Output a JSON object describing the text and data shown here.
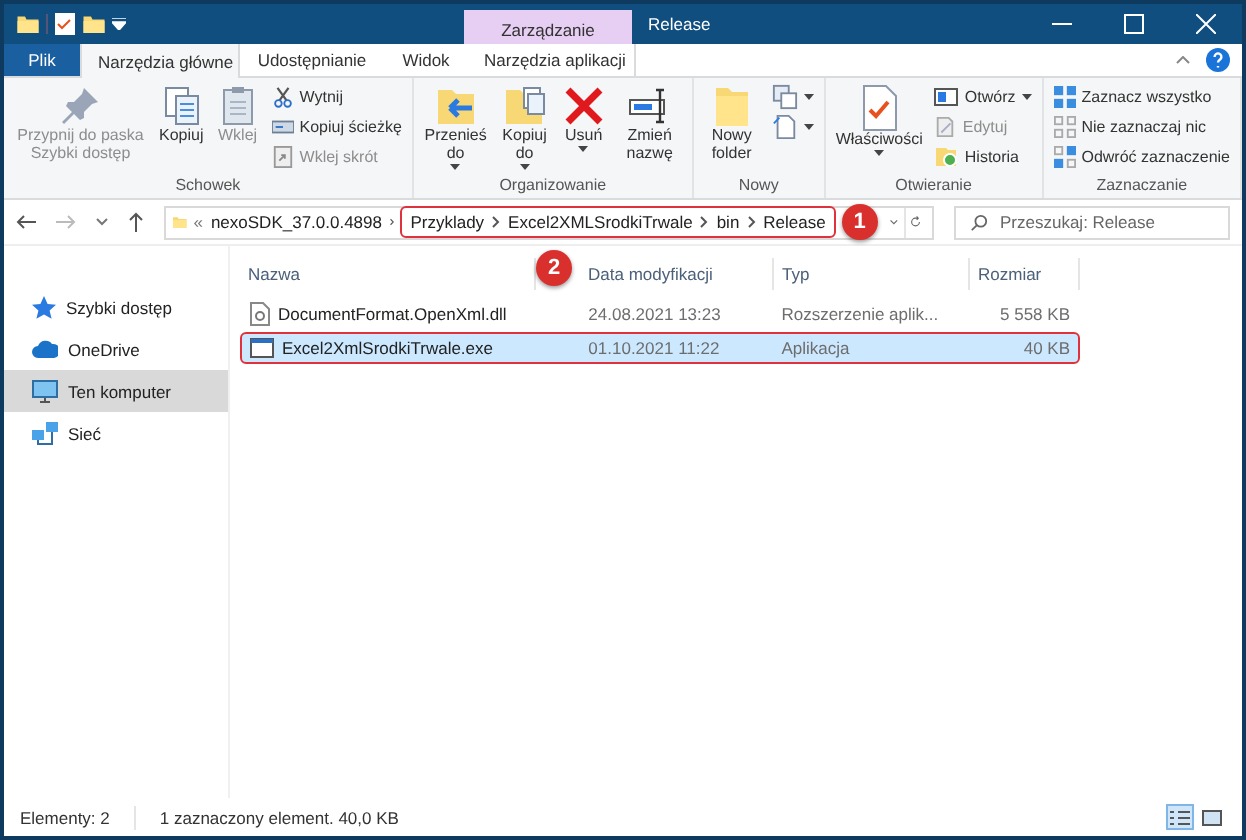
{
  "window": {
    "title": "Release",
    "context_header": "Zarządzanie"
  },
  "ribbon_tabs": [
    {
      "label": "Plik",
      "kind": "file",
      "selected": false
    },
    {
      "label": "Narzędzia główne",
      "kind": "tab",
      "selected": true
    },
    {
      "label": "Udostępnianie",
      "kind": "tab",
      "selected": false
    },
    {
      "label": "Widok",
      "kind": "tab",
      "selected": false
    },
    {
      "label": "Narzędzia aplikacji",
      "kind": "context",
      "selected": false
    }
  ],
  "ribbon_groups": [
    {
      "label": "Schowek",
      "items": [
        {
          "kind": "large",
          "label": "Przypnij do paska Szybki dostęp",
          "disabled": true,
          "dropdown": false
        },
        {
          "kind": "large",
          "label": "Kopiuj",
          "disabled": false,
          "dropdown": false
        },
        {
          "kind": "large",
          "label": "Wklej",
          "disabled": true,
          "dropdown": false
        },
        {
          "kind": "small",
          "label": "Wytnij",
          "disabled": false,
          "dropdown": false
        },
        {
          "kind": "small",
          "label": "Kopiuj ścieżkę",
          "disabled": false,
          "dropdown": false
        },
        {
          "kind": "small",
          "label": "Wklej skrót",
          "disabled": true,
          "dropdown": false
        }
      ]
    },
    {
      "label": "Organizowanie",
      "items": [
        {
          "kind": "large",
          "label": "Przenieś do",
          "disabled": false,
          "dropdown": true
        },
        {
          "kind": "large",
          "label": "Kopiuj do",
          "disabled": false,
          "dropdown": true
        },
        {
          "kind": "large",
          "label": "Usuń",
          "disabled": false,
          "dropdown": true
        },
        {
          "kind": "large",
          "label": "Zmień nazwę",
          "disabled": false,
          "dropdown": false
        }
      ]
    },
    {
      "label": "Nowy",
      "items": [
        {
          "kind": "large",
          "label": "Nowy folder",
          "disabled": false,
          "dropdown": false
        },
        {
          "kind": "icon",
          "disabled": false,
          "dropdown": true
        },
        {
          "kind": "icon",
          "disabled": false,
          "dropdown": true
        }
      ]
    },
    {
      "label": "Otwieranie",
      "items": [
        {
          "kind": "large",
          "label": "Właściwości",
          "disabled": false,
          "dropdown": true
        },
        {
          "kind": "small",
          "label": "Otwórz",
          "disabled": false,
          "dropdown": true
        },
        {
          "kind": "small",
          "label": "Edytuj",
          "disabled": true,
          "dropdown": false
        },
        {
          "kind": "small",
          "label": "Historia",
          "disabled": false,
          "dropdown": false
        }
      ]
    },
    {
      "label": "Zaznaczanie",
      "items": [
        {
          "kind": "small",
          "label": "Zaznacz wszystko",
          "disabled": false,
          "dropdown": false
        },
        {
          "kind": "small",
          "label": "Nie zaznaczaj nic",
          "disabled": false,
          "dropdown": false
        },
        {
          "kind": "small",
          "label": "Odwróć zaznaczenie",
          "disabled": false,
          "dropdown": false
        }
      ]
    }
  ],
  "address_bar": {
    "overflow": "«",
    "crumbs": [
      {
        "label": "nexoSDK_37.0.0.4898",
        "highlighted": false
      },
      {
        "label": "Przyklady",
        "highlighted": true
      },
      {
        "label": "Excel2XMLSrodkiTrwale",
        "highlighted": true
      },
      {
        "label": "bin",
        "highlighted": true
      },
      {
        "label": "Release",
        "highlighted": true
      }
    ]
  },
  "search": {
    "placeholder": "Przeszukaj: Release"
  },
  "sidebar": {
    "items": [
      {
        "label": "Szybki dostęp",
        "selected": false
      },
      {
        "label": "OneDrive",
        "selected": false
      },
      {
        "label": "Ten komputer",
        "selected": true
      },
      {
        "label": "Sieć",
        "selected": false
      }
    ]
  },
  "table": {
    "columns": [
      "Nazwa",
      "Data modyfikacji",
      "Typ",
      "Rozmiar"
    ],
    "rows": [
      {
        "name": "DocumentFormat.OpenXml.dll",
        "date": "24.08.2021 13:23",
        "type": "Rozszerzenie aplik...",
        "size": "5 558 KB",
        "selected": false,
        "highlighted": false
      },
      {
        "name": "Excel2XmlSrodkiTrwale.exe",
        "date": "01.10.2021 11:22",
        "type": "Aplikacja",
        "size": "40 KB",
        "selected": true,
        "highlighted": true
      }
    ]
  },
  "status_bar": {
    "count": "Elementy: 2",
    "selection": "1 zaznaczony element. 40,0 KB",
    "views": [
      {
        "selected": true
      },
      {
        "selected": false
      }
    ]
  },
  "annotations": [
    {
      "label": "1"
    },
    {
      "label": "2"
    }
  ]
}
